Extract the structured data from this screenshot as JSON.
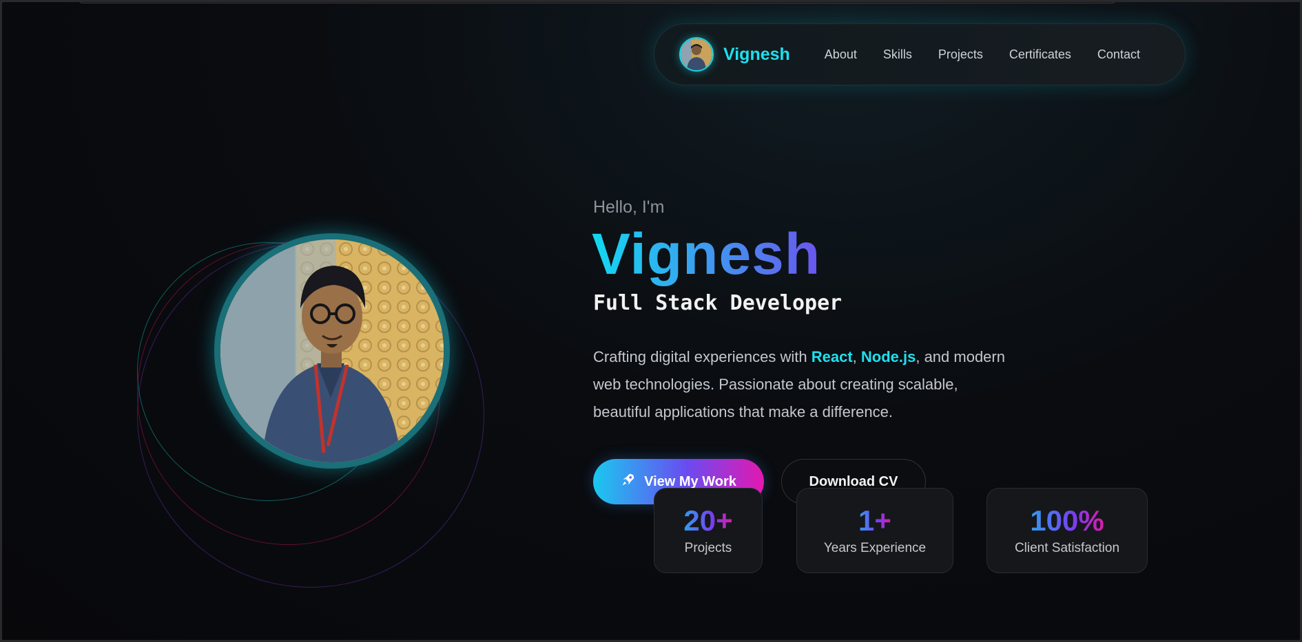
{
  "nav": {
    "brand": "Vignesh",
    "links": [
      {
        "label": "About"
      },
      {
        "label": "Skills"
      },
      {
        "label": "Projects"
      },
      {
        "label": "Certificates"
      },
      {
        "label": "Contact"
      }
    ]
  },
  "hero": {
    "greeting": "Hello, I'm",
    "name": "Vignesh",
    "role": "Full Stack Developer",
    "description": {
      "part1": "Crafting digital experiences with ",
      "highlight1": "React",
      "sep": ", ",
      "highlight2": "Node.js",
      "part2": ", and modern web technologies. Passionate about creating scalable, beautiful applications that make a difference."
    },
    "primary_button": {
      "label": "View My Work",
      "icon": "rocket-icon"
    },
    "secondary_button": {
      "label": "Download CV"
    }
  },
  "stats": [
    {
      "value": "20+",
      "label": "Projects"
    },
    {
      "value": "1+",
      "label": "Years Experience"
    },
    {
      "value": "100%",
      "label": "Client Satisfaction"
    }
  ],
  "colors": {
    "accent_cyan": "#1fe0ee",
    "accent_purple": "#6a55ee",
    "accent_pink": "#e418b0",
    "background": "#08080b"
  }
}
